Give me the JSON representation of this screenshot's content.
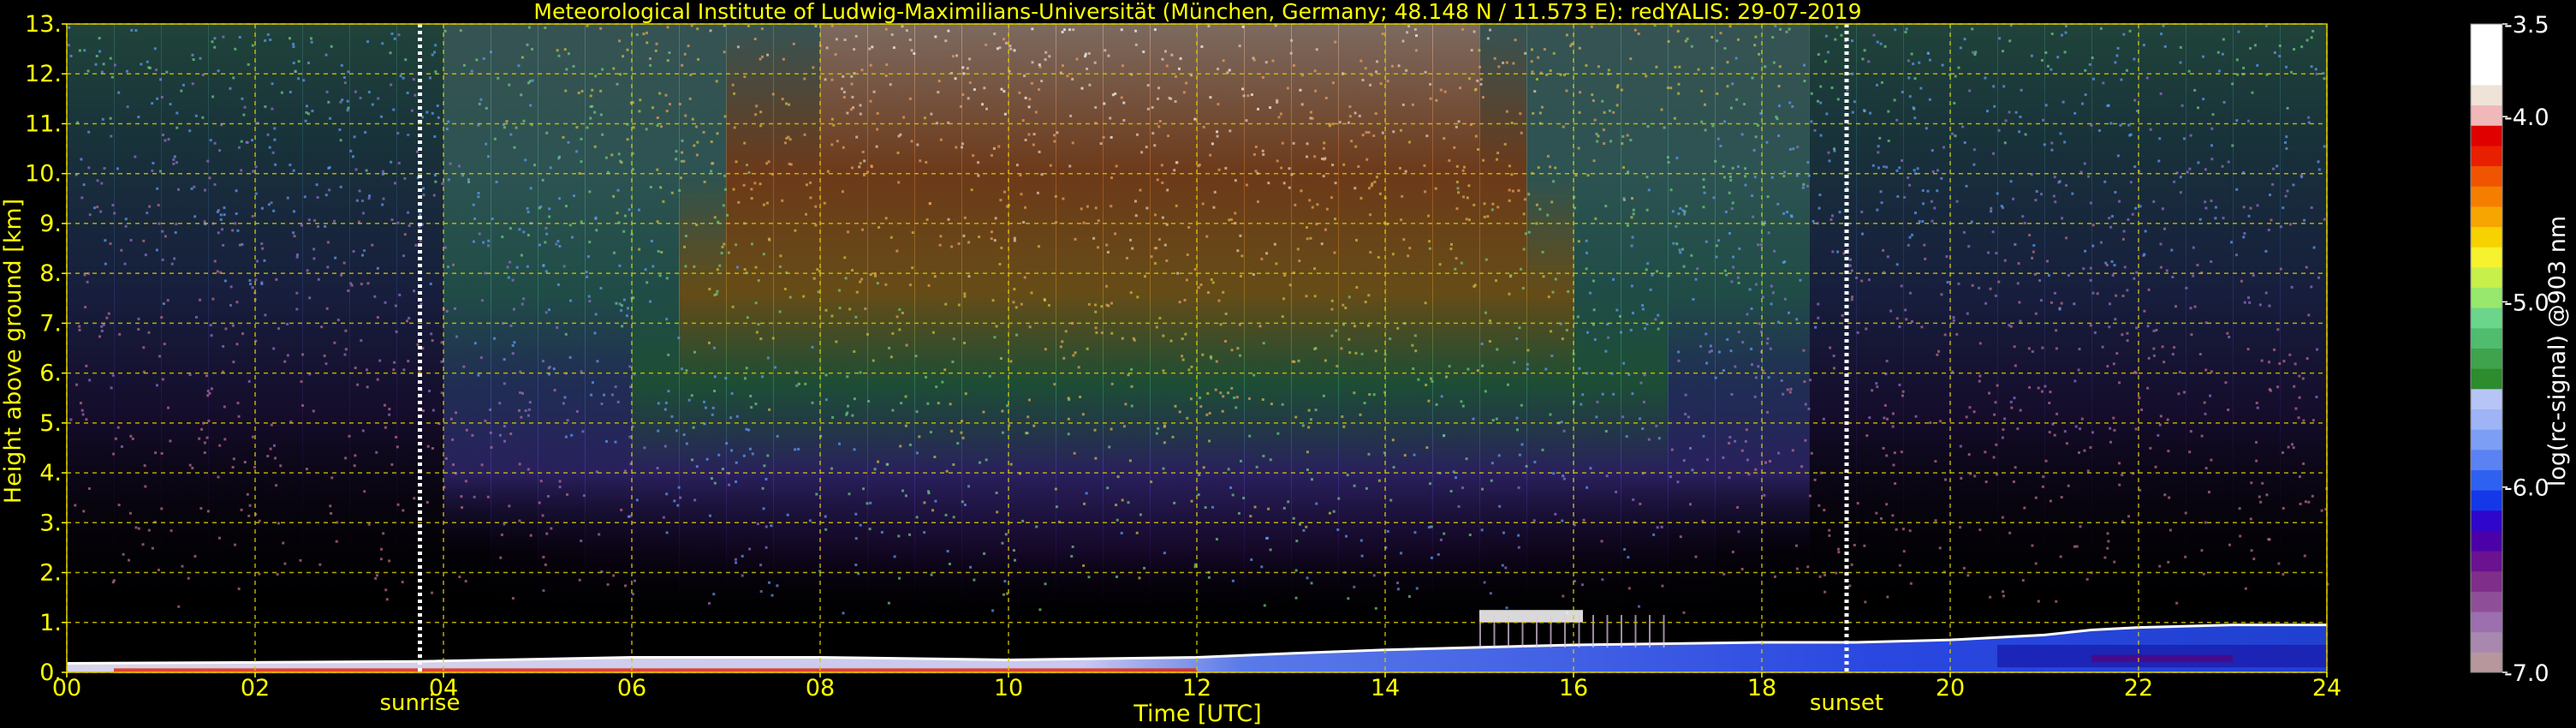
{
  "colors": {
    "background": "#000000",
    "text_yellow": "#ffff00",
    "grid": "#d8c800",
    "sun_line": "#ffffff",
    "colorbar_label": "#ffffff"
  },
  "chart_data": {
    "type": "heatmap",
    "title": "Meteorological Institute of Ludwig-Maximilians-Universität (München, Germany; 48.148 N / 11.573 E):    redYALIS: 29-07-2019",
    "xlabel": "Time [UTC]",
    "ylabel": "Height above ground [km]",
    "xlim": [
      0,
      24
    ],
    "ylim": [
      0,
      13
    ],
    "x_ticks": [
      "00",
      "02",
      "04",
      "06",
      "08",
      "10",
      "12",
      "14",
      "16",
      "18",
      "20",
      "22",
      "24"
    ],
    "y_ticks": [
      "0.",
      "1.",
      "2.",
      "3.",
      "4.",
      "5.",
      "6.",
      "7.",
      "8.",
      "9.",
      "10.",
      "11.",
      "12.",
      "13."
    ],
    "grid": true,
    "annotations": [
      {
        "label": "sunrise",
        "x": 3.75
      },
      {
        "label": "sunset",
        "x": 18.9
      }
    ],
    "colorbar": {
      "label": "log(rc-signal) @903 nm",
      "range": [
        -7.0,
        -3.5
      ],
      "ticks": [
        "-3.5",
        "-4.0",
        "-5.0",
        "-6.0",
        "-7.0"
      ],
      "colors": [
        "#b7979c",
        "#a988b0",
        "#9c6fae",
        "#8f4f98",
        "#7f2e8a",
        "#6a1290",
        "#4c00a8",
        "#2f06cc",
        "#1438e8",
        "#2f61f0",
        "#5b82f2",
        "#7c9ef5",
        "#9fb4f6",
        "#b7c5f6",
        "#2c8c2e",
        "#3ea34c",
        "#4fbd6d",
        "#6bd68b",
        "#97e86c",
        "#c7f04a",
        "#f6f22e",
        "#f5d200",
        "#f7a500",
        "#f57e00",
        "#f05400",
        "#e81f00",
        "#e00000",
        "#f0b8b8",
        "#efe3d7",
        "#ffffff",
        "#ffffff",
        "#ffffff"
      ]
    },
    "signal_regions": [
      {
        "description": "noise-dominated background, signal decreasing with height",
        "x": [
          0,
          24
        ],
        "y": [
          2.0,
          13.0
        ]
      },
      {
        "description": "boundary layer aerosol",
        "x": [
          0,
          24
        ],
        "y": [
          0.0,
          1.0
        ]
      },
      {
        "description": "cloud layer",
        "x": [
          15.0,
          16.1
        ],
        "y": [
          1.0,
          1.25
        ]
      }
    ],
    "boundary_layer_top": {
      "x": [
        0,
        2,
        3.75,
        6,
        8,
        10,
        12,
        13,
        14,
        16,
        18,
        19,
        20,
        21,
        21.5,
        22,
        23,
        24
      ],
      "y": [
        0.18,
        0.2,
        0.22,
        0.3,
        0.3,
        0.25,
        0.3,
        0.38,
        0.45,
        0.55,
        0.6,
        0.6,
        0.65,
        0.75,
        0.85,
        0.9,
        0.95,
        0.95
      ]
    }
  }
}
